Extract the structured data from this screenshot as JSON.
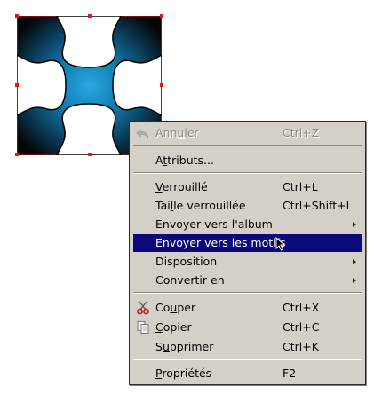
{
  "menu": {
    "items": [
      {
        "label": "Annuler",
        "mnemonic": "u",
        "accelerator": "Ctrl+Z",
        "icon": "undo-icon",
        "disabled": true
      },
      {
        "label": "Attributs...",
        "mnemonic": "t"
      },
      {
        "label": "Verrouillé",
        "mnemonic": "V",
        "accelerator": "Ctrl+L"
      },
      {
        "label": "Taille verrouillée",
        "mnemonic": "l",
        "accelerator": "Ctrl+Shift+L"
      },
      {
        "label": "Envoyer vers l'album",
        "submenu": true
      },
      {
        "label": "Envoyer vers les motifs",
        "highlighted": true
      },
      {
        "label": "Disposition",
        "submenu": true
      },
      {
        "label": "Convertir en",
        "submenu": true
      },
      {
        "label": "Couper",
        "mnemonic": "u",
        "accelerator": "Ctrl+X",
        "icon": "scissors-icon"
      },
      {
        "label": "Copier",
        "mnemonic": "C",
        "accelerator": "Ctrl+C",
        "icon": "copy-icon"
      },
      {
        "label": "Supprimer",
        "mnemonic": "u",
        "accelerator": "Ctrl+K"
      },
      {
        "label": "Propriétés",
        "mnemonic": "P",
        "accelerator": "F2"
      }
    ]
  },
  "colors": {
    "menu_bg": "#d4d0c8",
    "highlight": "#0a0a7a",
    "selection_handles": "#e8141b",
    "gradient_center": "#2a9fd6",
    "gradient_edge": "#0b0b0b"
  }
}
